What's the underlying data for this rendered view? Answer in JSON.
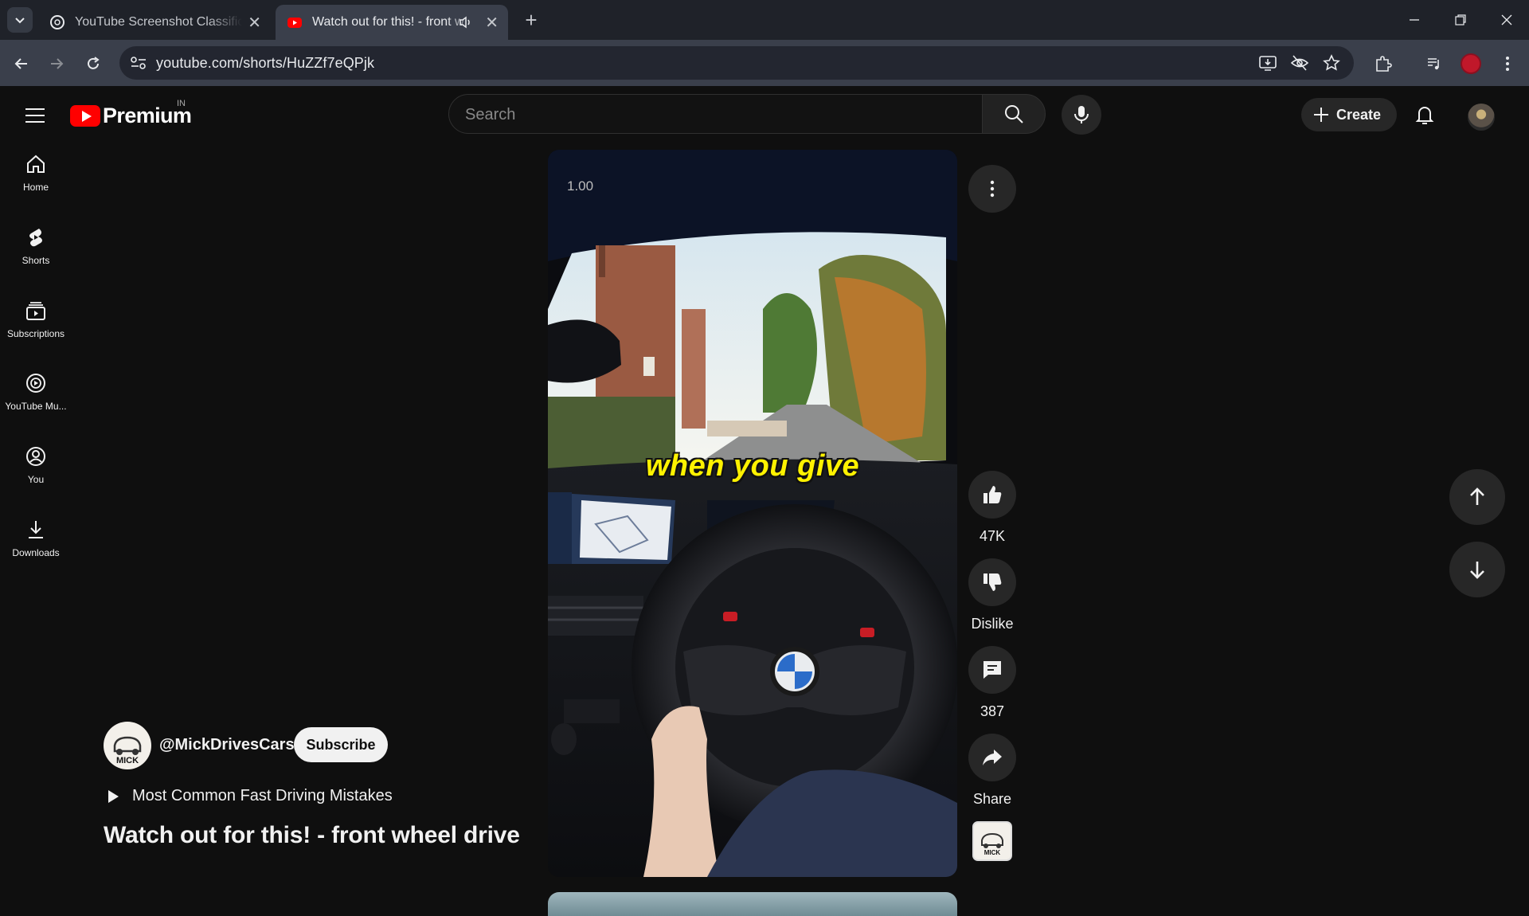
{
  "browser": {
    "tabs": [
      {
        "title": "YouTube Screenshot Classificati",
        "active": false
      },
      {
        "title": "Watch out for this! - front w",
        "active": true
      }
    ],
    "url": "youtube.com/shorts/HuZZf7eQPjk",
    "new_tab_label": "+"
  },
  "header": {
    "logo_text": "Premium",
    "country_code": "IN",
    "search_placeholder": "Search",
    "create_label": "Create"
  },
  "guide": {
    "items": [
      {
        "label": "Home",
        "icon": "home-icon"
      },
      {
        "label": "Shorts",
        "icon": "shorts-icon"
      },
      {
        "label": "Subscriptions",
        "icon": "subscriptions-icon"
      },
      {
        "label": "YouTube Mu...",
        "icon": "youtube-music-icon"
      },
      {
        "label": "You",
        "icon": "you-icon"
      },
      {
        "label": "Downloads",
        "icon": "download-icon"
      }
    ]
  },
  "player": {
    "speed_overlay": "1.00",
    "caption": "when you give"
  },
  "actions": {
    "like_count": "47K",
    "dislike_label": "Dislike",
    "comment_count": "387",
    "share_label": "Share"
  },
  "meta": {
    "channel_handle": "@MickDrivesCars",
    "subscribe_label": "Subscribe",
    "playlist_title": "Most Common Fast Driving Mistakes",
    "video_title": "Watch out for this! - front wheel drive",
    "channel_logo_text": "MICK"
  },
  "colors": {
    "brand_red": "#ff0000",
    "caption_yellow": "#fff200",
    "background": "#0f0f0f"
  }
}
